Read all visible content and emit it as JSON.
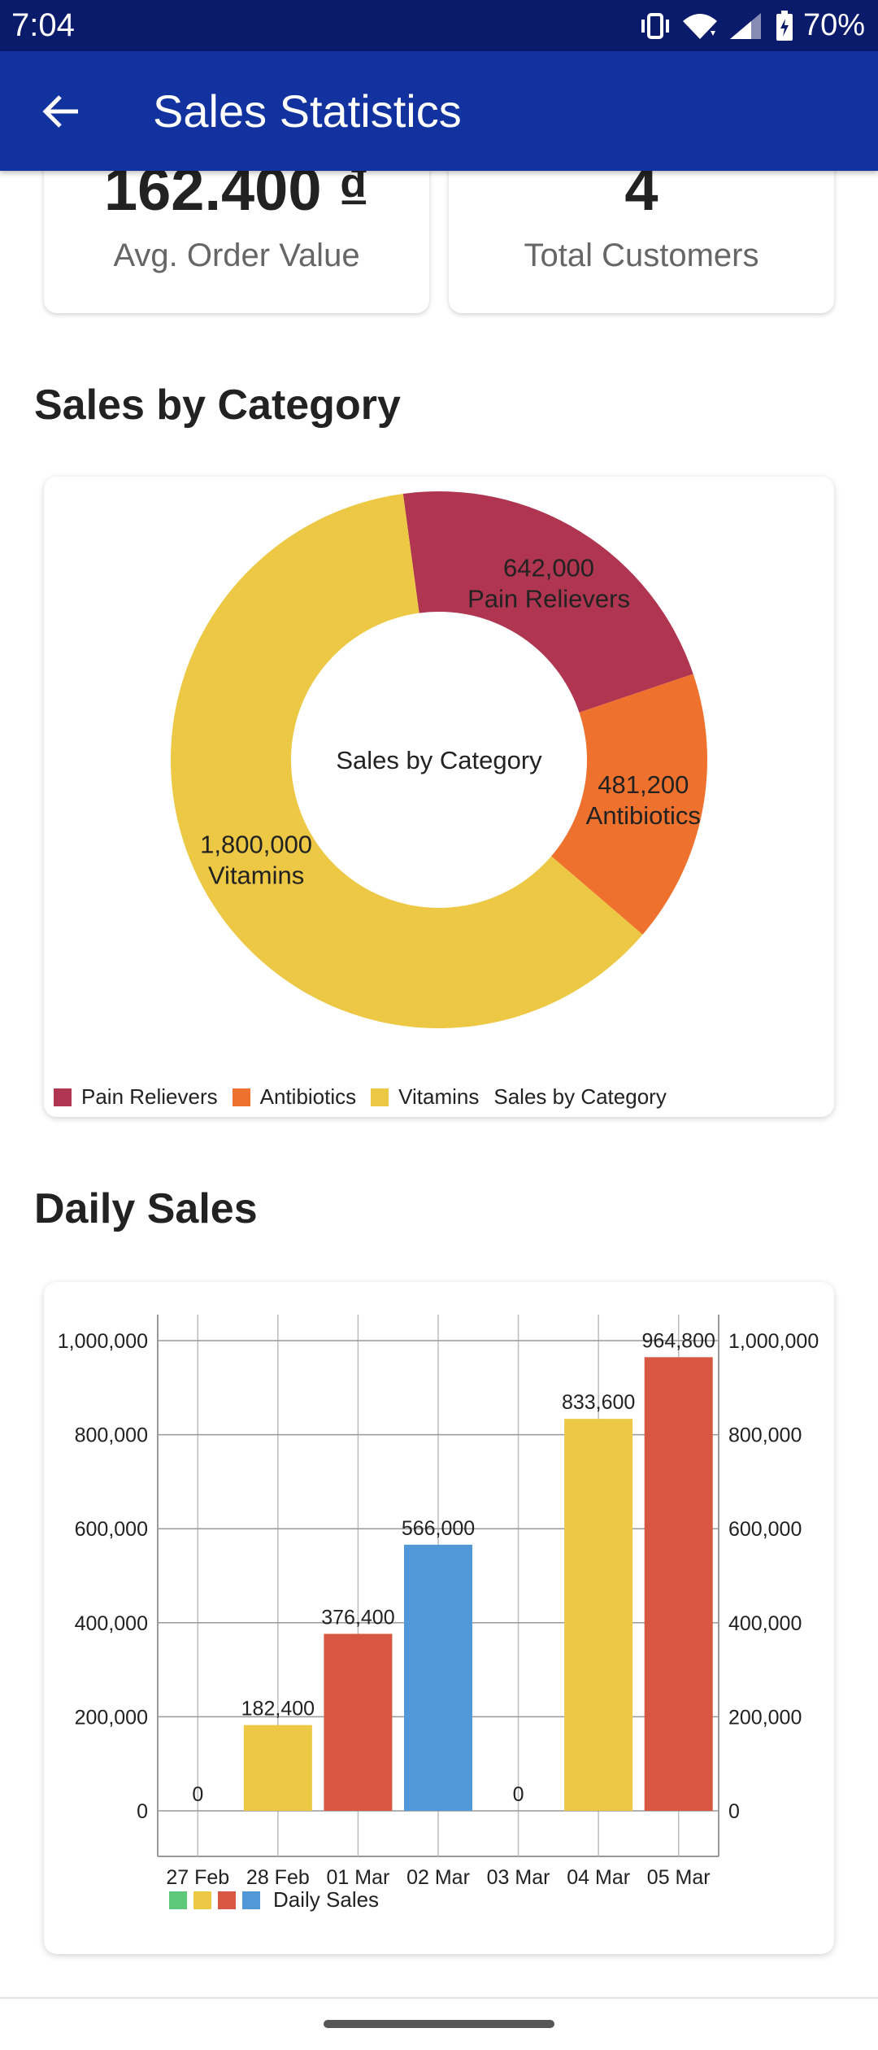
{
  "status_bar": {
    "time": "7:04",
    "battery": "70%",
    "icons": [
      "vibrate-icon",
      "wifi-icon",
      "signal-icon",
      "battery-icon"
    ]
  },
  "app_bar": {
    "title": "Sales Statistics",
    "back_icon": "arrow-left-icon"
  },
  "stats": {
    "avg_order": {
      "value": "162.400 ₫",
      "label": "Avg. Order Value"
    },
    "total_customers": {
      "value": "4",
      "label": "Total Customers"
    }
  },
  "sections": {
    "category_title": "Sales by Category",
    "daily_title": "Daily Sales"
  },
  "colors": {
    "status_bar": "#0b1b6b",
    "app_bar": "#1232a0",
    "pain": "#b03550",
    "antibiotics": "#ee722e",
    "vitamins": "#ecc844",
    "green": "#5dc77a",
    "blue": "#5198d8",
    "red": "#d85743"
  },
  "chart_data": [
    {
      "type": "pie",
      "donut": true,
      "center_label": "Sales by Category",
      "legend_title": "Sales by Category",
      "legend_position": "bottom-left",
      "slices": [
        {
          "label": "Pain Relievers",
          "value": 642000,
          "value_label": "642,000",
          "color": "#b03550"
        },
        {
          "label": "Antibiotics",
          "value": 481200,
          "value_label": "481,200",
          "color": "#ee722e"
        },
        {
          "label": "Vitamins",
          "value": 1800000,
          "value_label": "1,800,000",
          "color": "#ecc844"
        }
      ]
    },
    {
      "type": "bar",
      "categories": [
        "27 Feb",
        "28 Feb",
        "01 Mar",
        "02 Mar",
        "03 Mar",
        "04 Mar",
        "05 Mar"
      ],
      "series": [
        {
          "name": "Daily Sales",
          "values": [
            0,
            182400,
            376400,
            566000,
            0,
            833600,
            964800
          ],
          "value_labels": [
            "0",
            "182,400",
            "376,400",
            "566,000",
            "0",
            "833,600",
            "964,800"
          ],
          "colors": [
            "#5dc77a",
            "#ecc844",
            "#d85743",
            "#5198d8",
            "#5dc77a",
            "#ecc844",
            "#d85743"
          ]
        }
      ],
      "ylim": [
        0,
        1000000
      ],
      "yticks": [
        0,
        200000,
        400000,
        600000,
        800000,
        1000000
      ],
      "ytick_labels": [
        "0",
        "200,000",
        "400,000",
        "600,000",
        "800,000",
        "1,000,000"
      ],
      "grid": true,
      "dual_y_axis": true,
      "legend_colors": [
        "#5dc77a",
        "#ecc844",
        "#d85743",
        "#5198d8"
      ],
      "legend_position": "bottom-left"
    }
  ]
}
